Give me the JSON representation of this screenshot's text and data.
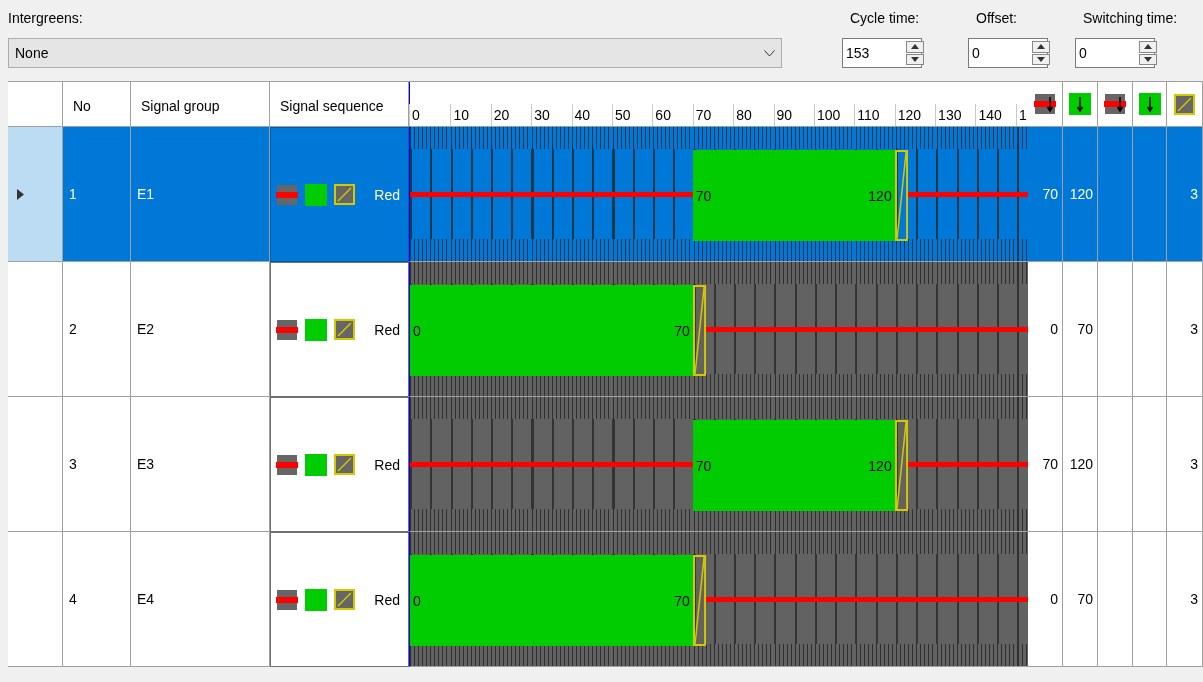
{
  "intergreens": {
    "label": "Intergreens:",
    "value": "None"
  },
  "cycle_time": {
    "label": "Cycle time:",
    "value": "153"
  },
  "offset": {
    "label": "Offset:",
    "value": "0"
  },
  "switching_time": {
    "label": "Switching time:",
    "value": "0"
  },
  "table": {
    "columns": [
      "No",
      "Signal group",
      "Signal sequence"
    ],
    "timeline_ticks": [
      "0",
      "10",
      "20",
      "30",
      "40",
      "50",
      "60",
      "70",
      "80",
      "90",
      "100",
      "110",
      "120",
      "130",
      "140",
      "1"
    ],
    "rows": [
      {
        "no": "1",
        "group": "E1",
        "sequence": "Red",
        "selected": true,
        "green": {
          "start": "70",
          "end": "120"
        },
        "value_1": "70",
        "value_2": "120",
        "amber": "3"
      },
      {
        "no": "2",
        "group": "E2",
        "sequence": "Red",
        "selected": false,
        "green": {
          "start": "0",
          "end": "70"
        },
        "value_1": "0",
        "value_2": "70",
        "amber": "3"
      },
      {
        "no": "3",
        "group": "E3",
        "sequence": "Red",
        "selected": false,
        "green": {
          "start": "70",
          "end": "120"
        },
        "value_1": "70",
        "value_2": "120",
        "amber": "3"
      },
      {
        "no": "4",
        "group": "E4",
        "sequence": "Red",
        "selected": false,
        "green": {
          "start": "0",
          "end": "70"
        },
        "value_1": "0",
        "value_2": "70",
        "amber": "3"
      }
    ]
  }
}
